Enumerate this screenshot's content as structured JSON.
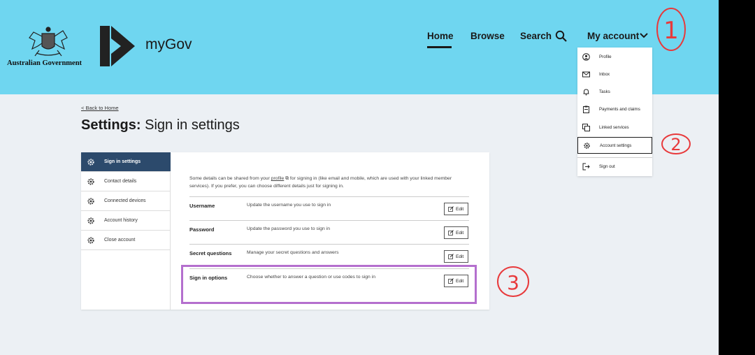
{
  "header": {
    "gov_name": "Australian Government",
    "brand": "myGov",
    "nav": {
      "home": "Home",
      "browse": "Browse",
      "search": "Search",
      "account": "My account"
    }
  },
  "dropdown": {
    "items": [
      {
        "label": "Profile",
        "icon": "user-icon"
      },
      {
        "label": "Inbox",
        "icon": "mail-icon"
      },
      {
        "label": "Tasks",
        "icon": "bell-icon"
      },
      {
        "label": "Payments and claims",
        "icon": "clipboard-icon"
      },
      {
        "label": "Linked services",
        "icon": "link-icon"
      },
      {
        "label": "Account settings",
        "icon": "gear-icon"
      },
      {
        "label": "Sign out",
        "icon": "sign-out-icon"
      }
    ],
    "selected": "Account settings"
  },
  "page": {
    "back": "< Back to Home",
    "title_bold": "Settings:",
    "title_rest": " Sign in settings"
  },
  "side_nav": [
    {
      "label": "Sign in settings",
      "active": true
    },
    {
      "label": "Contact details"
    },
    {
      "label": "Connected devices"
    },
    {
      "label": "Account history"
    },
    {
      "label": "Close account"
    }
  ],
  "intro": {
    "part1": "Some details can be shared from your ",
    "link": "profile",
    "part2": " for signing in (like email and mobile, which are used with your linked member services). If you prefer, you can choose different details just for signing in."
  },
  "rows": [
    {
      "label": "Username",
      "desc": "Update the username you use to sign in",
      "button": "Edit"
    },
    {
      "label": "Password",
      "desc": "Update the password you use to sign in",
      "button": "Edit"
    },
    {
      "label": "Secret questions",
      "desc": "Manage your secret questions and answers",
      "button": "Edit"
    },
    {
      "label": "Sign in options",
      "desc": "Choose whether to answer a question or use codes to sign in",
      "button": "Edit"
    }
  ],
  "annotations": [
    "1",
    "2",
    "3"
  ],
  "colors": {
    "header_bg": "#6fd6f0",
    "page_bg": "#ecf0f4",
    "active_nav": "#2c4a6c",
    "annotation_red": "#e8393b",
    "annotation_purple": "#b46fce"
  }
}
